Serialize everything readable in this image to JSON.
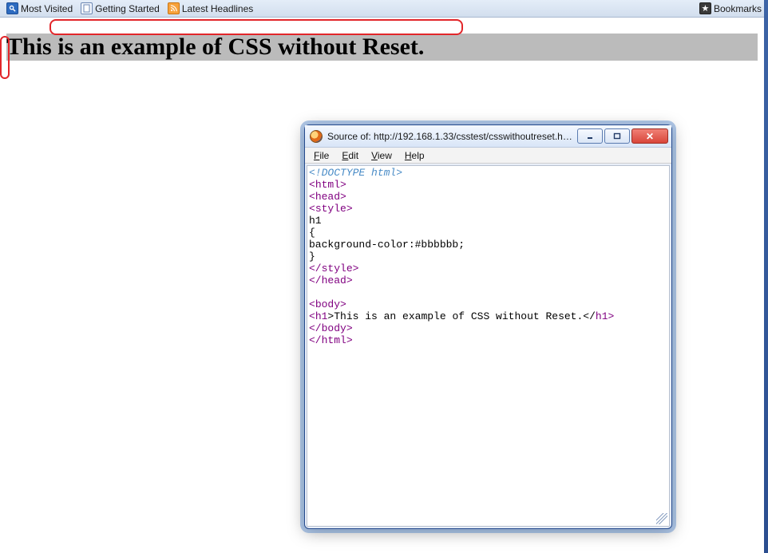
{
  "toolbar": {
    "items": [
      {
        "label": "Most Visited",
        "icon": "search-icon"
      },
      {
        "label": "Getting Started",
        "icon": "page-icon"
      },
      {
        "label": "Latest Headlines",
        "icon": "rss-icon"
      }
    ],
    "bookmarks_label": "Bookmarks"
  },
  "page": {
    "heading": "This is an example of CSS without Reset."
  },
  "source_window": {
    "title": "Source of: http://192.168.1.33/csstest/csswithoutreset.html - ...",
    "menu": {
      "file": "File",
      "edit": "Edit",
      "view": "View",
      "help": "Help"
    },
    "code": {
      "l1": "<!DOCTYPE html>",
      "l2_open": "<",
      "l2_tag": "html",
      "l2_close": ">",
      "l3_open": "<",
      "l3_tag": "head",
      "l3_close": ">",
      "l4_open": "<",
      "l4_tag": "style",
      "l4_close": ">",
      "l5": "h1",
      "l6": "{",
      "l7": "background-color:#bbbbbb;",
      "l8": "}",
      "l9_open": "</",
      "l9_tag": "style",
      "l9_close": ">",
      "l10_open": "</",
      "l10_tag": "head",
      "l10_close": ">",
      "blank": "",
      "l11_open": "<",
      "l11_tag": "body",
      "l11_close": ">",
      "l12_open": "<",
      "l12_tag": "h1",
      "l12_mid": ">This is an example of CSS without Reset.</",
      "l12_tag2": "h1",
      "l12_close": ">",
      "l13_open": "</",
      "l13_tag": "body",
      "l13_close": ">",
      "l14_open": "</",
      "l14_tag": "html",
      "l14_close": ">"
    }
  }
}
